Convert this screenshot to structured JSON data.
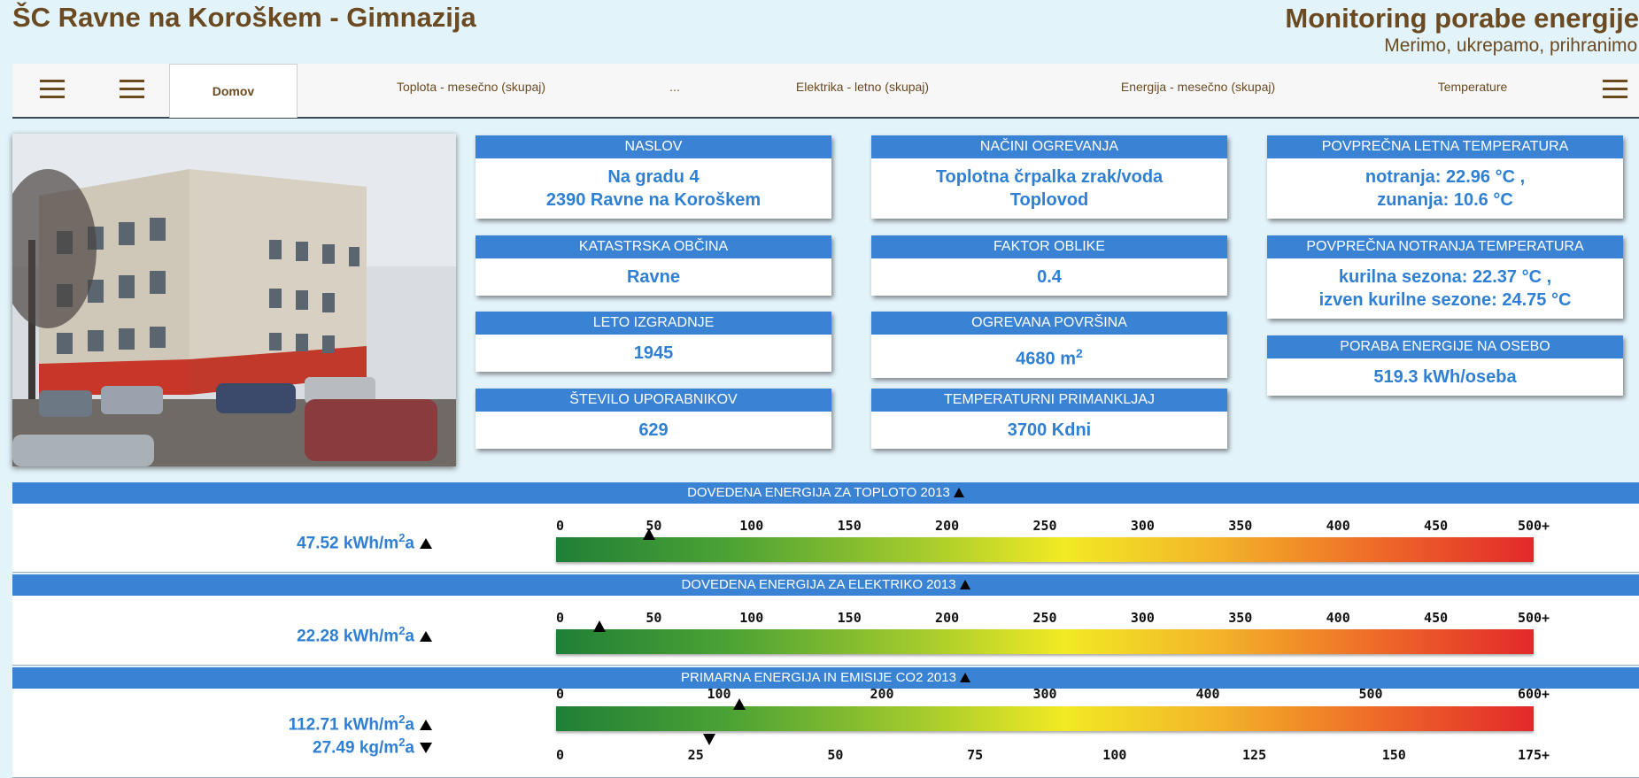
{
  "header": {
    "title": "ŠC Ravne na Koroškem - Gimnazija",
    "brand_title": "Monitoring porabe energije",
    "brand_subtitle": "Merimo, ukrepamo, prihranimo!"
  },
  "nav": {
    "tabs": [
      {
        "label": "Domov",
        "active": true
      },
      {
        "label": "Toplota - mesečno (skupaj)"
      },
      {
        "label": "..."
      },
      {
        "label": "Elektrika - letno (skupaj)"
      },
      {
        "label": "Energija - mesečno (skupaj)"
      },
      {
        "label": "Temperature"
      }
    ]
  },
  "cards": {
    "naslov": {
      "title": "NASLOV",
      "line1": "Na gradu 4",
      "line2": "2390 Ravne na Koroškem"
    },
    "katastrska": {
      "title": "KATASTRSKA OBČINA",
      "value": "Ravne"
    },
    "leto": {
      "title": "LETO IZGRADNJE",
      "value": "1945"
    },
    "uporabniki": {
      "title": "ŠTEVILO UPORABNIKOV",
      "value": "629"
    },
    "ogrevanje": {
      "title": "NAČINI OGREVANJA",
      "line1": "Toplotna črpalka zrak/voda",
      "line2": "Toplovod"
    },
    "faktor": {
      "title": "FAKTOR OBLIKE",
      "value": "0.4"
    },
    "povrsina": {
      "title": "OGREVANA POVRŠINA",
      "value": "4680 m",
      "unit_sup": "2"
    },
    "primanjkljaj": {
      "title": "TEMPERATURNI PRIMANKLJAJ",
      "value": "3700 Kdni"
    },
    "letna_temp": {
      "title": "POVPREČNA LETNA TEMPERATURA",
      "line1": "notranja: 22.96 °C ,",
      "line2": "zunanja: 10.6 °C"
    },
    "notranja_temp": {
      "title": "POVPREČNA NOTRANJA TEMPERATURA",
      "line1": "kurilna sezona: 22.37 °C ,",
      "line2": "izven kurilne sezone: 24.75 °C"
    },
    "poraba_osebo": {
      "title": "PORABA ENERGIJE NA OSEBO",
      "value": "519.3 kWh/oseba"
    }
  },
  "energy": {
    "toplota": {
      "title": "DOVEDENA ENERGIJA ZA TOPLOTO 2013",
      "value": "47.52 kWh/m",
      "sup": "2",
      "suffix": "a"
    },
    "elektrika": {
      "title": "DOVEDENA ENERGIJA ZA ELEKTRIKO 2013",
      "value": "22.28 kWh/m",
      "sup": "2",
      "suffix": "a"
    },
    "primarna": {
      "title": "PRIMARNA ENERGIJA IN EMISIJE CO2 2013",
      "value1": "112.71 kWh/m",
      "sup1": "2",
      "suffix1": "a",
      "value2": "27.49 kg/m",
      "sup2": "2",
      "suffix2": "a"
    }
  },
  "chart_data": [
    {
      "type": "bar",
      "title": "DOVEDENA ENERGIJA ZA TOPLOTO 2013",
      "scale": [
        0,
        500
      ],
      "tick_labels": [
        "0",
        "50",
        "100",
        "150",
        "200",
        "250",
        "300",
        "350",
        "400",
        "450",
        "500+"
      ],
      "value": 47.52
    },
    {
      "type": "bar",
      "title": "DOVEDENA ENERGIJA ZA ELEKTRIKO 2013",
      "scale": [
        0,
        500
      ],
      "tick_labels": [
        "0",
        "50",
        "100",
        "150",
        "200",
        "250",
        "300",
        "350",
        "400",
        "450",
        "500+"
      ],
      "value": 22.28
    },
    {
      "type": "bar",
      "title": "PRIMARNA ENERGIJA IN EMISIJE CO2 2013",
      "scale_top": [
        0,
        600
      ],
      "tick_labels_top": [
        "0",
        "100",
        "200",
        "300",
        "400",
        "500",
        "600+"
      ],
      "value_top": 112.71,
      "scale_bottom": [
        0,
        175
      ],
      "tick_labels_bottom": [
        "0",
        "25",
        "50",
        "75",
        "100",
        "125",
        "150",
        "175+"
      ],
      "value_bottom": 27.49
    }
  ]
}
